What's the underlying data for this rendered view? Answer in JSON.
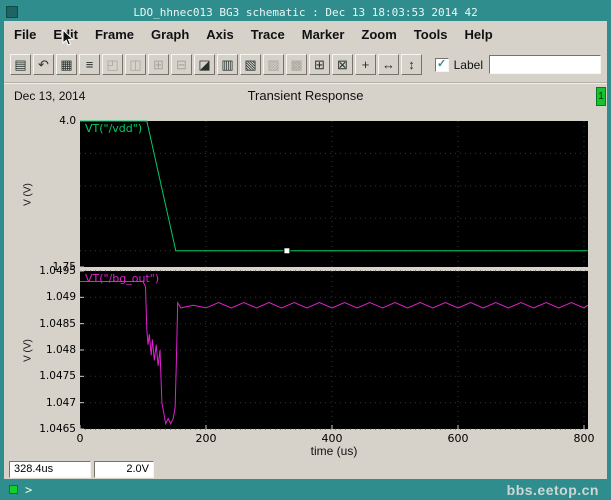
{
  "window": {
    "title": "LDO_hhnec013 BG3 schematic : Dec 13 18:03:53 2014 42"
  },
  "menu": {
    "items": [
      {
        "label": "File"
      },
      {
        "label": "Edit"
      },
      {
        "label": "Frame"
      },
      {
        "label": "Graph"
      },
      {
        "label": "Axis"
      },
      {
        "label": "Trace"
      },
      {
        "label": "Marker"
      },
      {
        "label": "Zoom"
      },
      {
        "label": "Tools"
      },
      {
        "label": "Help"
      }
    ]
  },
  "toolbar": {
    "label_text": "Label",
    "input_value": "",
    "icons": [
      {
        "name": "printer-icon",
        "glyph": "▤"
      },
      {
        "name": "redraw-icon",
        "glyph": "↶"
      },
      {
        "name": "table-icon",
        "glyph": "▦"
      },
      {
        "name": "list-icon",
        "glyph": "≡"
      },
      {
        "name": "new-subwindow-icon",
        "glyph": "◰",
        "disabled": true
      },
      {
        "name": "copy-window-icon",
        "glyph": "◫",
        "disabled": true
      },
      {
        "name": "add-subwindow-icon",
        "glyph": "⊞",
        "disabled": true
      },
      {
        "name": "delete-subwindow-icon",
        "glyph": "⊟",
        "disabled": true
      },
      {
        "name": "overlay-mode-icon",
        "glyph": "◪"
      },
      {
        "name": "strip-chart-icon",
        "glyph": "▥"
      },
      {
        "name": "composite-mode-icon",
        "glyph": "▧"
      },
      {
        "name": "hatch-fill-icon",
        "glyph": "▨",
        "disabled": true
      },
      {
        "name": "dense-fill-icon",
        "glyph": "▩",
        "disabled": true
      },
      {
        "name": "grid-toggle-icon",
        "glyph": "⊞"
      },
      {
        "name": "zoom-fit-icon",
        "glyph": "⊠"
      },
      {
        "name": "pan-icon",
        "glyph": "+"
      },
      {
        "name": "zoom-x-icon",
        "glyph": "↔"
      },
      {
        "name": "zoom-y-icon",
        "glyph": "↕"
      }
    ]
  },
  "header": {
    "date": "Dec 13, 2014",
    "title": "Transient Response",
    "window_number": "1"
  },
  "status": {
    "x_value": "328.4us",
    "y_value": "2.0V",
    "prompt": ">"
  },
  "watermark": "bbs.eetop.cn",
  "colors": {
    "frame_teal": "#2f8e8d",
    "panel_gray": "#d6d2ca",
    "plot_background": "#000000",
    "vdd_trace": "#00cc66",
    "bgout_trace": "#e020d0",
    "badge_green": "#16c22e"
  },
  "chart_data": [
    {
      "type": "line",
      "label": "VT(\"/vdd\")",
      "color": "#00cc66",
      "ylabel": "V (V)",
      "ylim": [
        1.75,
        4.0
      ],
      "yticks": [
        4.0,
        1.75
      ],
      "ytick_labels": [
        "4.0",
        "1.75"
      ],
      "grid_y": [
        3.5,
        3.0,
        2.5,
        2.0
      ],
      "xlim": [
        0,
        806
      ],
      "xticks": [
        0,
        200,
        400,
        600,
        800
      ],
      "xtick_labels": [
        "0",
        "200",
        "400",
        "600",
        "800"
      ],
      "points": [
        [
          0,
          4.0
        ],
        [
          106,
          4.0
        ],
        [
          152,
          2.0
        ],
        [
          806,
          2.0
        ]
      ],
      "marker": {
        "x": 328.4,
        "y": 2.0
      }
    },
    {
      "type": "line",
      "label": "VT(\"/bg_out\")",
      "color": "#e020d0",
      "ylabel": "V (V)",
      "xlabel": "time (us)",
      "ylim": [
        1.0465,
        1.0495
      ],
      "yticks": [
        1.0495,
        1.049,
        1.0485,
        1.048,
        1.0475,
        1.047,
        1.0465
      ],
      "ytick_labels": [
        "1.0495",
        "1.049",
        "1.0485",
        "1.048",
        "1.0475",
        "1.047",
        "1.0465"
      ],
      "grid_y": [
        1.0495,
        1.049,
        1.0485,
        1.048,
        1.0475,
        1.047,
        1.0465
      ],
      "xlim": [
        0,
        806
      ],
      "xticks": [
        0,
        200,
        400,
        600,
        800
      ],
      "xtick_labels": [
        "0",
        "200",
        "400",
        "600",
        "800"
      ],
      "points": [
        [
          0,
          1.0493
        ],
        [
          100,
          1.0493
        ],
        [
          104,
          1.0492
        ],
        [
          106,
          1.0484
        ],
        [
          108,
          1.0481
        ],
        [
          110,
          1.0483
        ],
        [
          113,
          1.0479
        ],
        [
          115,
          1.0482
        ],
        [
          118,
          1.0478
        ],
        [
          121,
          1.0481
        ],
        [
          124,
          1.0477
        ],
        [
          127,
          1.048
        ],
        [
          130,
          1.047
        ],
        [
          133,
          1.0468
        ],
        [
          136,
          1.0466
        ],
        [
          140,
          1.0467
        ],
        [
          144,
          1.0466
        ],
        [
          148,
          1.0467
        ],
        [
          151,
          1.0469
        ],
        [
          153,
          1.0478
        ],
        [
          155,
          1.0489
        ],
        [
          160,
          1.0488
        ],
        [
          180,
          1.04885
        ],
        [
          200,
          1.0488
        ],
        [
          220,
          1.0489
        ],
        [
          240,
          1.0488
        ],
        [
          260,
          1.0489
        ],
        [
          280,
          1.0488
        ],
        [
          300,
          1.0489
        ],
        [
          320,
          1.0488
        ],
        [
          340,
          1.0489
        ],
        [
          360,
          1.0488
        ],
        [
          380,
          1.0489
        ],
        [
          400,
          1.0488
        ],
        [
          420,
          1.0489
        ],
        [
          440,
          1.0488
        ],
        [
          460,
          1.0489
        ],
        [
          480,
          1.0488
        ],
        [
          500,
          1.0489
        ],
        [
          520,
          1.0488
        ],
        [
          540,
          1.0489
        ],
        [
          560,
          1.0488
        ],
        [
          580,
          1.0489
        ],
        [
          600,
          1.0488
        ],
        [
          620,
          1.0489
        ],
        [
          640,
          1.0488
        ],
        [
          660,
          1.0489
        ],
        [
          680,
          1.0488
        ],
        [
          700,
          1.0489
        ],
        [
          720,
          1.0488
        ],
        [
          740,
          1.0489
        ],
        [
          760,
          1.0488
        ],
        [
          780,
          1.0489
        ],
        [
          800,
          1.0488
        ],
        [
          806,
          1.04885
        ]
      ]
    }
  ]
}
